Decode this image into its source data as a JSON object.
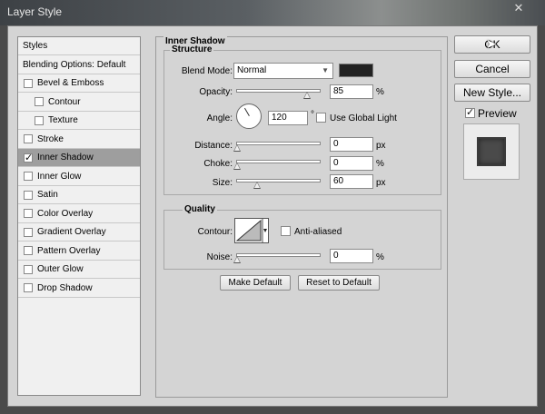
{
  "window": {
    "title": "Layer Style",
    "close_glyph": "✕"
  },
  "sidebar": {
    "items": [
      {
        "label": "Styles",
        "type": "header"
      },
      {
        "label": "Blending Options: Default",
        "type": "header"
      },
      {
        "label": "Bevel & Emboss",
        "checked": false
      },
      {
        "label": "Contour",
        "checked": false,
        "sub": true
      },
      {
        "label": "Texture",
        "checked": false,
        "sub": true
      },
      {
        "label": "Stroke",
        "checked": false
      },
      {
        "label": "Inner Shadow",
        "checked": true,
        "active": true
      },
      {
        "label": "Inner Glow",
        "checked": false
      },
      {
        "label": "Satin",
        "checked": false
      },
      {
        "label": "Color Overlay",
        "checked": false
      },
      {
        "label": "Gradient Overlay",
        "checked": false
      },
      {
        "label": "Pattern Overlay",
        "checked": false
      },
      {
        "label": "Outer Glow",
        "checked": false
      },
      {
        "label": "Drop Shadow",
        "checked": false
      }
    ]
  },
  "inner_shadow": {
    "title": "Inner Shadow",
    "structure": {
      "title": "Structure",
      "blend_mode_label": "Blend Mode:",
      "blend_mode_value": "Normal",
      "shadow_color": "#222222",
      "opacity_label": "Opacity:",
      "opacity_value": "85",
      "opacity_level": 0.85,
      "opacity_unit": "%",
      "angle_label": "Angle:",
      "angle_value": "120",
      "angle_unit": "°",
      "use_global_light_label": "Use Global Light",
      "use_global_light": false,
      "distance_label": "Distance:",
      "distance_value": "0",
      "distance_level": 0,
      "distance_unit": "px",
      "choke_label": "Choke:",
      "choke_value": "0",
      "choke_level": 0,
      "choke_unit": "%",
      "size_label": "Size:",
      "size_value": "60",
      "size_level": 0.24,
      "size_unit": "px"
    },
    "quality": {
      "title": "Quality",
      "contour_label": "Contour:",
      "anti_aliased_label": "Anti-aliased",
      "anti_aliased": false,
      "noise_label": "Noise:",
      "noise_value": "0",
      "noise_level": 0,
      "noise_unit": "%"
    },
    "make_default_label": "Make Default",
    "reset_default_label": "Reset to Default"
  },
  "actions": {
    "ok_label": "OK",
    "cancel_label": "Cancel",
    "new_style_label": "New Style...",
    "preview_label": "Preview",
    "preview_checked": true
  }
}
